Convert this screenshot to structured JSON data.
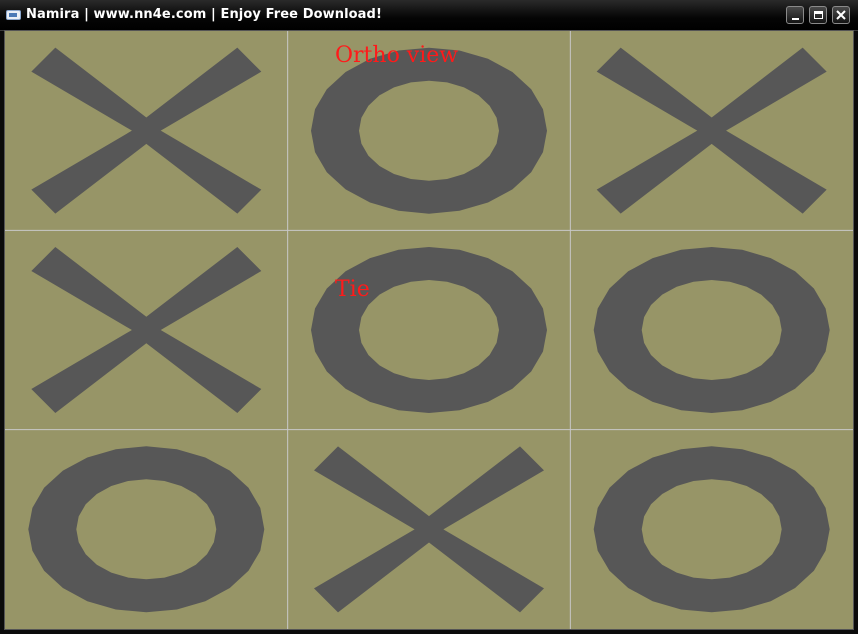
{
  "window": {
    "title": "Namira | www.nn4e.com | Enjoy Free Download!",
    "buttons": [
      "minimize",
      "maximize",
      "close"
    ]
  },
  "viewport": {
    "view_mode_label": "Ortho view",
    "status_label": "Tie",
    "background_color": "#979567",
    "grid_line_color": "#c8c8c8",
    "piece_color": "#575757",
    "label_color": "#ff1a1a"
  },
  "board": {
    "rows": 3,
    "cols": 3,
    "cells": [
      [
        "X",
        "O",
        "X"
      ],
      [
        "X",
        "O",
        "O"
      ],
      [
        "O",
        "X",
        "O"
      ]
    ]
  }
}
